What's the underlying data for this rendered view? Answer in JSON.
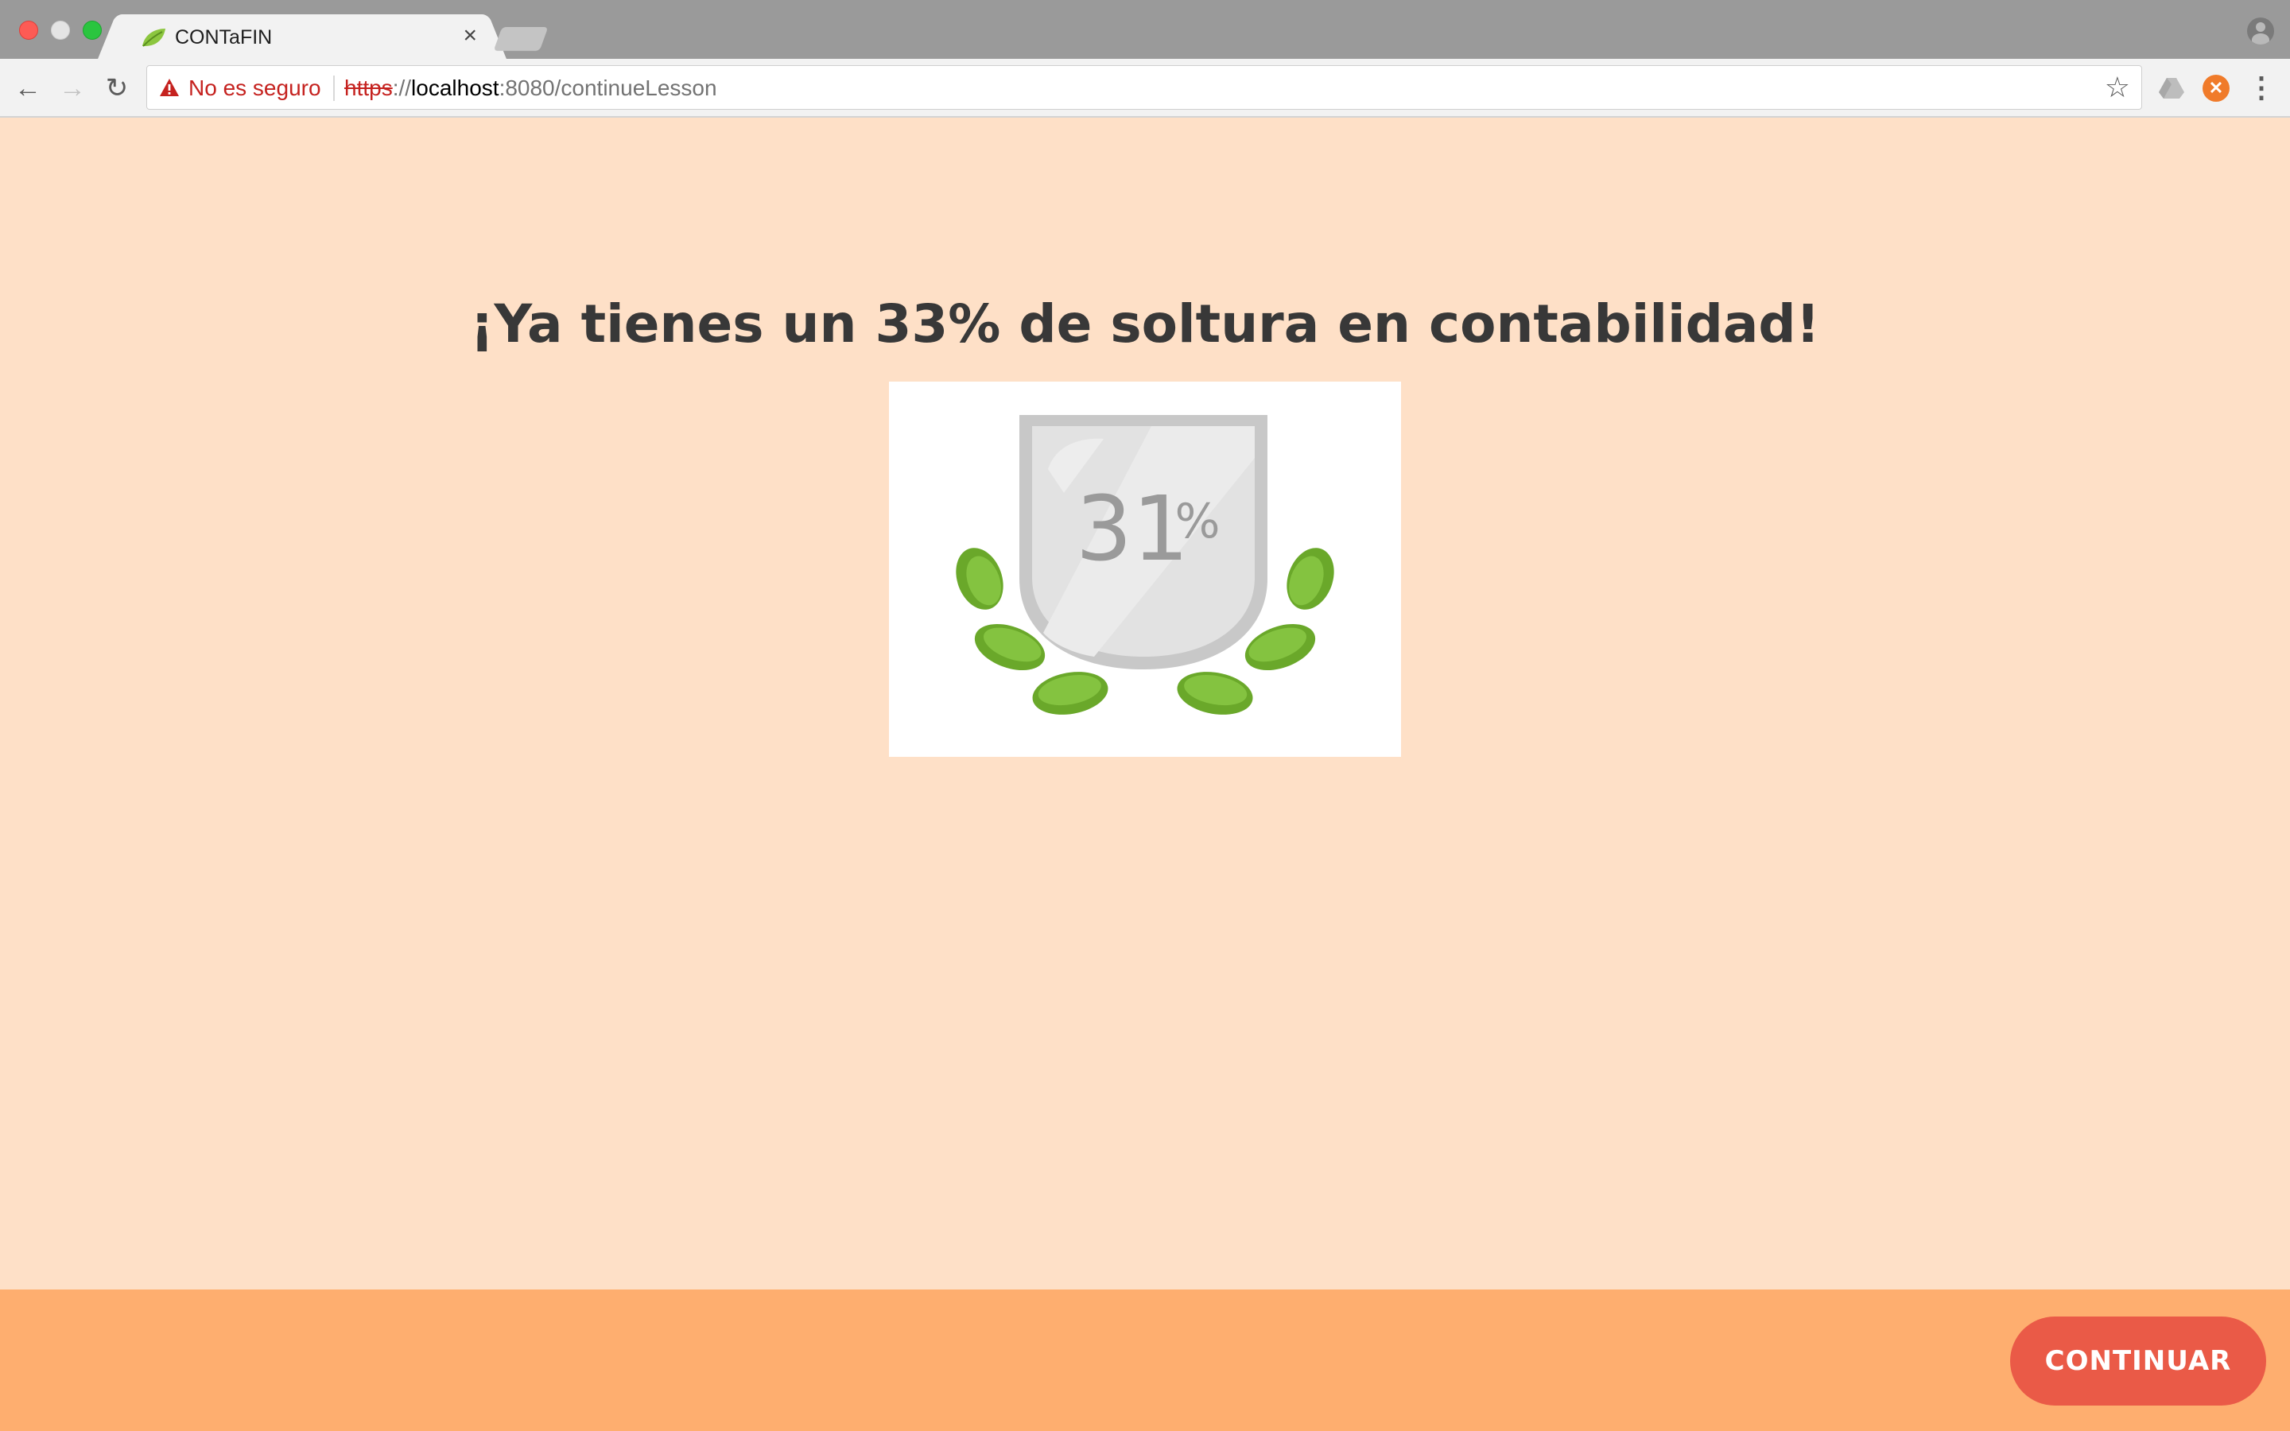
{
  "browser": {
    "tab_title": "CONTaFIN",
    "tab_close": "×",
    "security_label": "No es seguro",
    "url_scheme": "https",
    "url_separator": "://",
    "url_host": "localhost",
    "url_rest": ":8080/continueLesson",
    "icons": {
      "back": "←",
      "forward": "→",
      "reload": "↻",
      "star": "☆",
      "menu": "⋮"
    }
  },
  "main": {
    "heading": "¡Ya tienes un 33% de soltura en contabilidad!",
    "badge": {
      "percent_number": "31",
      "percent_sign": "%"
    }
  },
  "footer": {
    "continue_label": "CONTINUAR"
  },
  "colors": {
    "page_background": "#fee0c7",
    "footer_background": "#feae6f",
    "button_background": "#ea5a47",
    "security_warning": "#c5221f",
    "leaf_green": "#7ab52d"
  }
}
